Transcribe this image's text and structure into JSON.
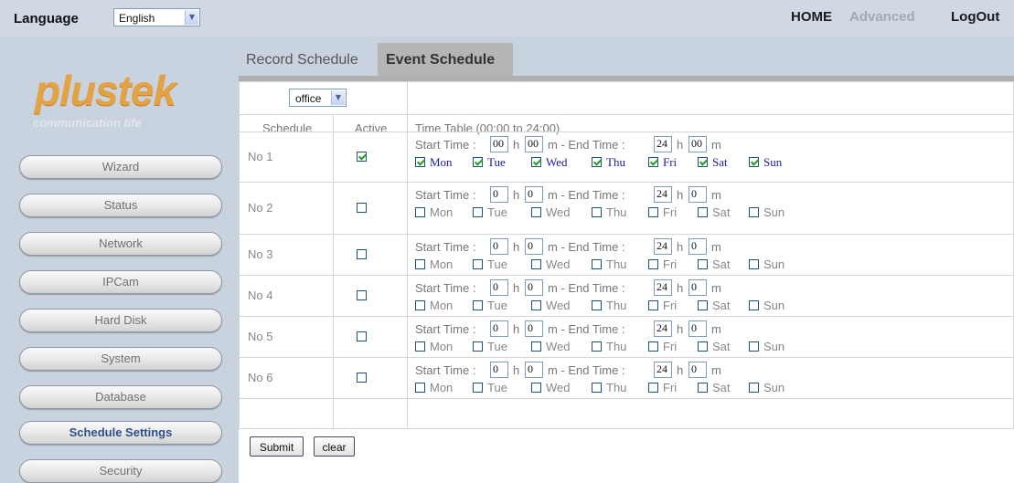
{
  "topbar": {
    "language_label": "Language",
    "language_value": "English",
    "home": "HOME",
    "advanced": "Advanced",
    "logout": "LogOut"
  },
  "brand": {
    "logo": "plustek",
    "tagline": "communication life",
    "logo_color": "#e3a243"
  },
  "sidebar": {
    "items": [
      {
        "label": "Wizard"
      },
      {
        "label": "Status"
      },
      {
        "label": "Network"
      },
      {
        "label": "IPCam"
      },
      {
        "label": "Hard Disk"
      },
      {
        "label": "System"
      },
      {
        "label": "Database"
      },
      {
        "label": "Schedule Settings",
        "active": true
      },
      {
        "label": "Security"
      }
    ]
  },
  "tabs": [
    {
      "label": "Record Schedule",
      "selected": false
    },
    {
      "label": "Event Schedule",
      "selected": true
    }
  ],
  "table": {
    "camera_select": "office",
    "headers": {
      "schedule": "Schedule",
      "active": "Active",
      "timetable": "Time Table (00:00 to 24:00)"
    },
    "labels": {
      "start": "Start Time :",
      "h": "h",
      "m_end": "m - End Time :",
      "m": "m"
    },
    "days": [
      "Mon",
      "Tue",
      "Wed",
      "Thu",
      "Fri",
      "Sat",
      "Sun"
    ],
    "rows": [
      {
        "name": "No 1",
        "active": true,
        "start_h": "00",
        "start_m": "00",
        "end_h": "24",
        "end_m": "00",
        "days_on": [
          true,
          true,
          true,
          true,
          true,
          true,
          true
        ]
      },
      {
        "name": "No 2",
        "active": false,
        "start_h": "0",
        "start_m": "0",
        "end_h": "24",
        "end_m": "0",
        "days_on": [
          false,
          false,
          false,
          false,
          false,
          false,
          false
        ]
      },
      {
        "name": "No 3",
        "active": false,
        "start_h": "0",
        "start_m": "0",
        "end_h": "24",
        "end_m": "0",
        "days_on": [
          false,
          false,
          false,
          false,
          false,
          false,
          false
        ]
      },
      {
        "name": "No 4",
        "active": false,
        "start_h": "0",
        "start_m": "0",
        "end_h": "24",
        "end_m": "0",
        "days_on": [
          false,
          false,
          false,
          false,
          false,
          false,
          false
        ]
      },
      {
        "name": "No 5",
        "active": false,
        "start_h": "0",
        "start_m": "0",
        "end_h": "24",
        "end_m": "0",
        "days_on": [
          false,
          false,
          false,
          false,
          false,
          false,
          false
        ]
      },
      {
        "name": "No 6",
        "active": false,
        "start_h": "0",
        "start_m": "0",
        "end_h": "24",
        "end_m": "0",
        "days_on": [
          false,
          false,
          false,
          false,
          false,
          false,
          false
        ]
      }
    ]
  },
  "buttons": {
    "submit": "Submit",
    "clear": "clear"
  }
}
